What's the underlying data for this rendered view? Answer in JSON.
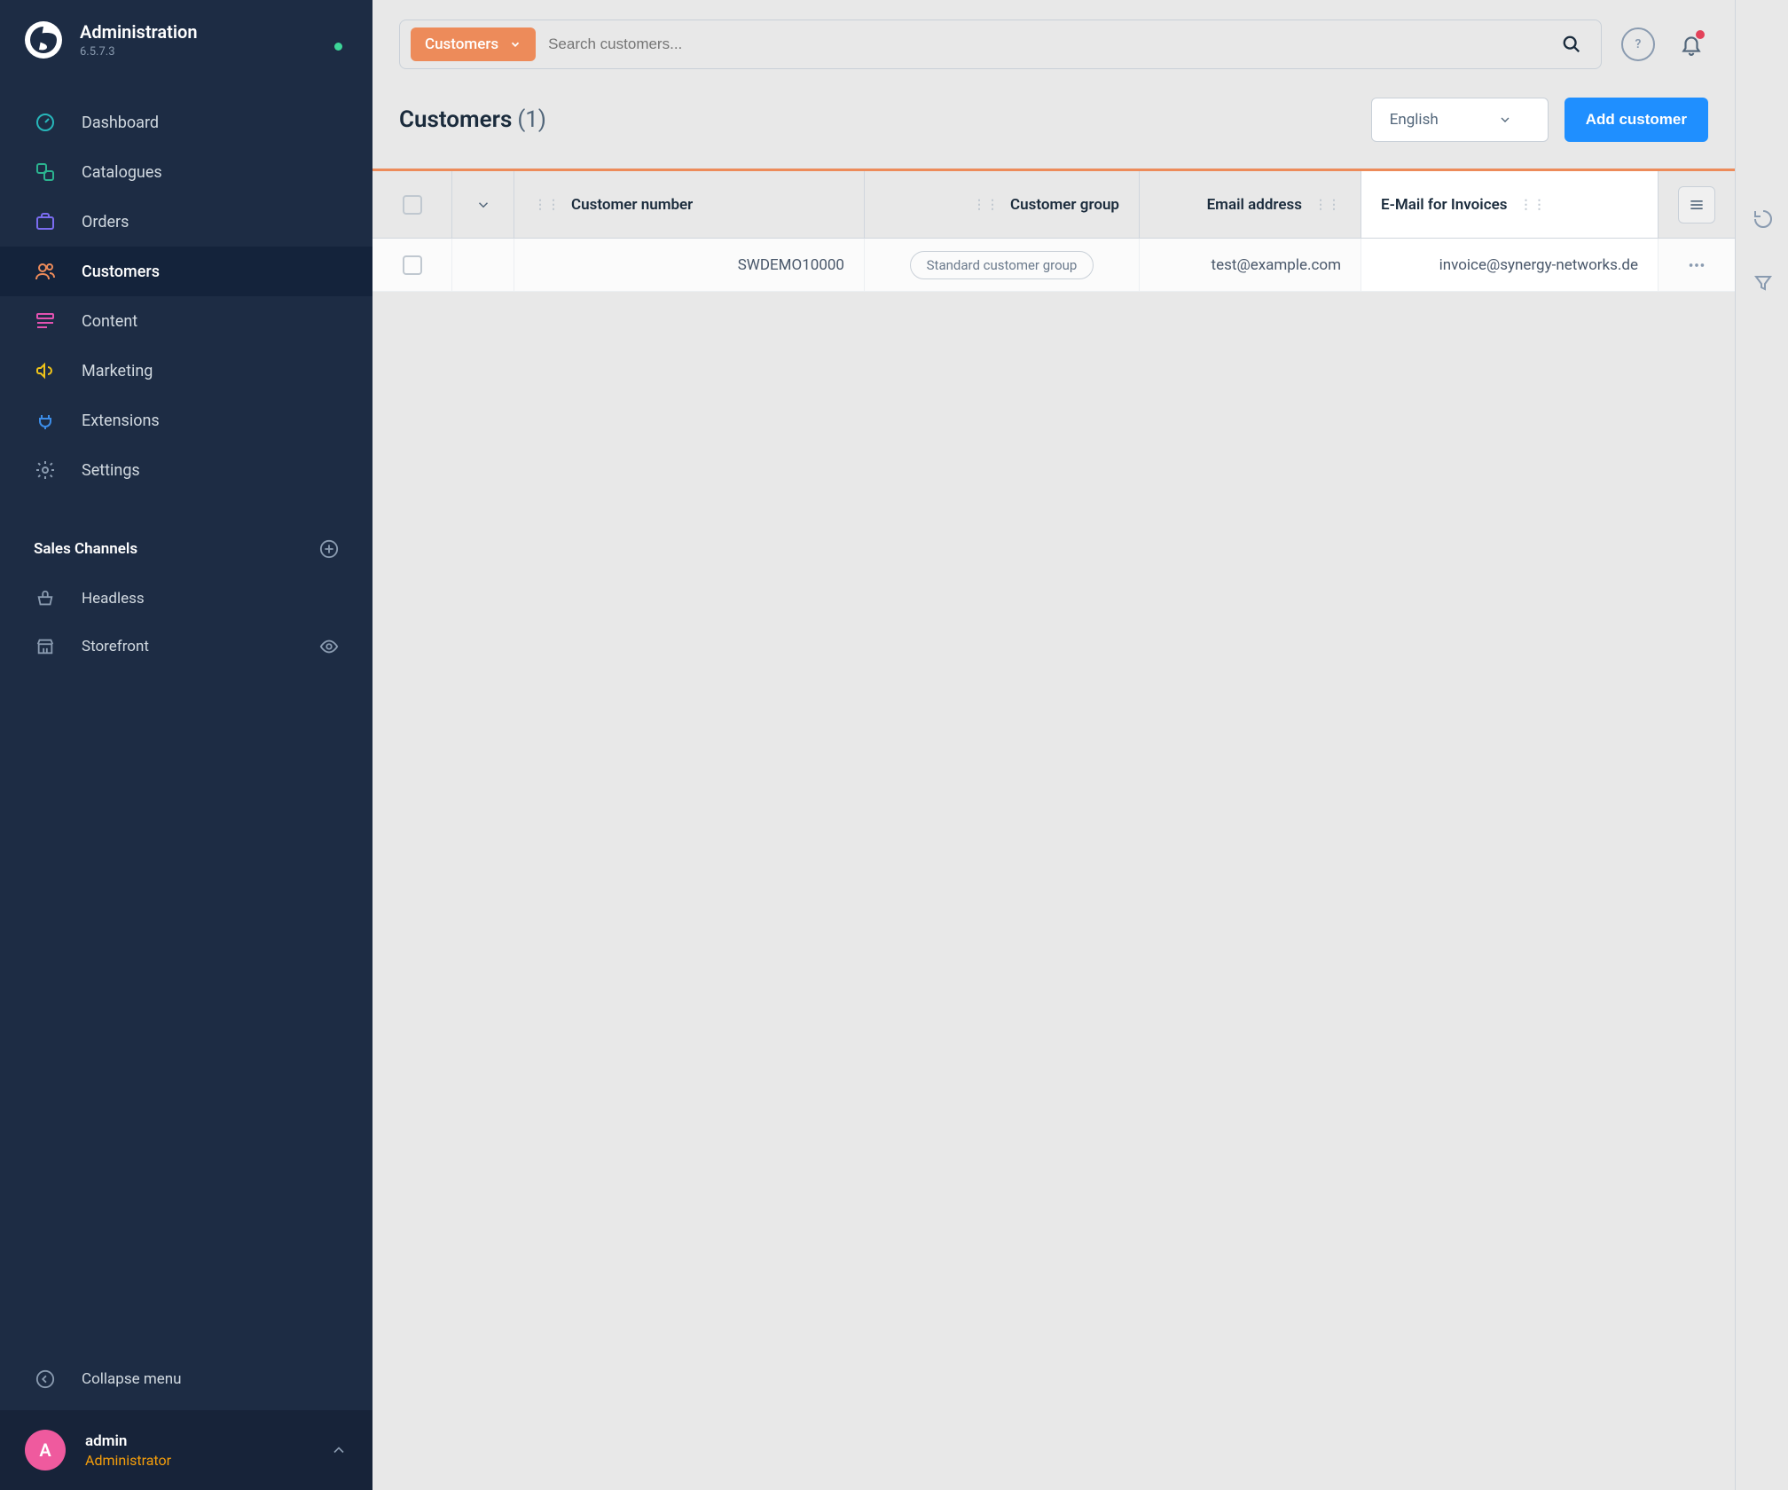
{
  "app": {
    "title": "Administration",
    "version": "6.5.7.3"
  },
  "nav": {
    "dashboard": "Dashboard",
    "catalogues": "Catalogues",
    "orders": "Orders",
    "customers": "Customers",
    "content": "Content",
    "marketing": "Marketing",
    "extensions": "Extensions",
    "settings": "Settings"
  },
  "sales_channels": {
    "title": "Sales Channels",
    "headless": "Headless",
    "storefront": "Storefront"
  },
  "collapse_label": "Collapse menu",
  "user": {
    "initial": "A",
    "name": "admin",
    "role": "Administrator"
  },
  "search": {
    "scope": "Customers",
    "placeholder": "Search customers..."
  },
  "page": {
    "title": "Customers",
    "count": "(1)",
    "language": "English",
    "add_button": "Add customer"
  },
  "table": {
    "columns": {
      "customer_number": "Customer number",
      "customer_group": "Customer group",
      "email": "Email address",
      "invoice_email": "E-Mail for Invoices"
    },
    "rows": [
      {
        "customer_number": "SWDEMO10000",
        "customer_group": "Standard customer group",
        "email": "test@example.com",
        "invoice_email": "invoice@synergy-networks.de"
      }
    ]
  }
}
